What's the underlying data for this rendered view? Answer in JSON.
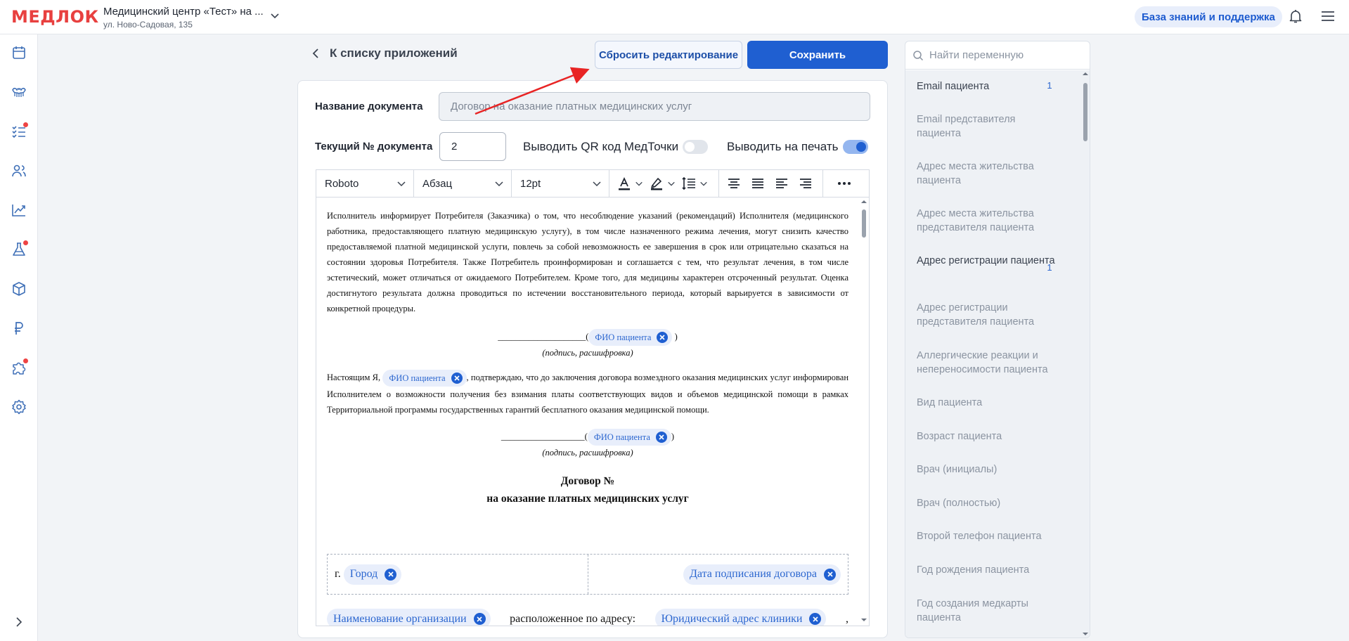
{
  "header": {
    "logo": "МЕДЛОК",
    "clinic_name": "Медицинский центр «Тест» на ...",
    "clinic_address": "ул. Ново-Садовая, 135",
    "kb_button": "База знаний и поддержка"
  },
  "rail": {
    "icons": [
      "calendar-icon",
      "teeth-icon",
      "checklist-icon",
      "users-icon",
      "chart-icon",
      "flask-icon",
      "box-icon",
      "ruble-icon",
      "puzzle-icon",
      "gear-icon"
    ],
    "badge_color": "#ee4444",
    "expand_icon": "chevron-right-icon"
  },
  "editor": {
    "back_label": "К списку приложений",
    "reset_label": "Сбросить редактирование",
    "save_label": "Сохранить",
    "doc_name_label": "Название документа",
    "doc_name_placeholder": "Договор на оказание платных медицинских услуг",
    "doc_number_label": "Текущий № документа",
    "doc_number_value": "2",
    "qr_label": "Выводить QR код МедТочки",
    "qr_enabled": false,
    "print_label": "Выводить на печать",
    "print_enabled": true
  },
  "toolbar": {
    "font": "Roboto",
    "block": "Абзац",
    "size": "12pt"
  },
  "document": {
    "p1": "Исполнитель информирует Потребителя (Заказчика) о том, что несоблюдение указаний (рекомендаций) Исполнителя (медицинского работника, предоставляющего платную медицинскую услугу), в том числе назначенного режима лечения, могут снизить качество предоставляемой платной медицинской услуги, повлечь за собой невозможность ее завершения в срок или отрицательно сказаться на состоянии здоровья Потребителя. Также Потребитель проинформирован и соглашается с тем, что результат лечения, в том числе эстетический, может отличаться от ожидаемого Потребителем. Кроме того, для медицины характерен отсроченный результат. Оценка достигнутого результата должна проводиться по истечении восстановительного периода, который варьируется в зависимости от конкретной процедуры.",
    "sign_line": "____________________(",
    "sign_line_2": "___________________(",
    "sign_close": ")",
    "chip_patient": "ФИО пациента",
    "sign_caption": "(подпись, расшифровка)",
    "p2_start": "Настоящим Я,",
    "p2_rest": ", подтверждаю, что до заключения договора возмездного оказания медицинских услуг информирован Исполнителем о возможности получения без взимания платы соответствующих видов и объемов медицинской помощи в рамках Территориальной программы государственных гарантий бесплатного оказания медицинской помощи.",
    "contract_title_1": "Договор №",
    "contract_title_2": "на оказание платных медицинских услуг",
    "city_prefix": "г.",
    "chip_city": "Город",
    "chip_date": "Дата подписания договора",
    "chip_org": "Наименование организации",
    "located_text": "расположенное по адресу:",
    "chip_address": "Юридический адрес клиники",
    "comma": ","
  },
  "variables": {
    "search_placeholder": "Найти переменную",
    "items": [
      {
        "label": "Email пациента",
        "count": "1"
      },
      {
        "label": "Email представителя пациента"
      },
      {
        "label": "Адрес места жительства пациента"
      },
      {
        "label": "Адрес места жительства представителя пациента"
      },
      {
        "label": "Адрес регистрации пациента",
        "count": "1"
      },
      {
        "label": "Адрес регистрации представителя пациента"
      },
      {
        "label": "Аллергические реакции и непереносимости пациента"
      },
      {
        "label": "Вид пациента"
      },
      {
        "label": "Возраст пациента"
      },
      {
        "label": "Врач (инициалы)"
      },
      {
        "label": "Врач (полностью)"
      },
      {
        "label": "Второй телефон пациента"
      },
      {
        "label": "Год рождения пациента"
      },
      {
        "label": "Год создания медкарты пациента"
      }
    ]
  },
  "colors": {
    "accent": "#1f5fd1",
    "brand": "#e8403f",
    "annotation_arrow": "#e82424"
  }
}
